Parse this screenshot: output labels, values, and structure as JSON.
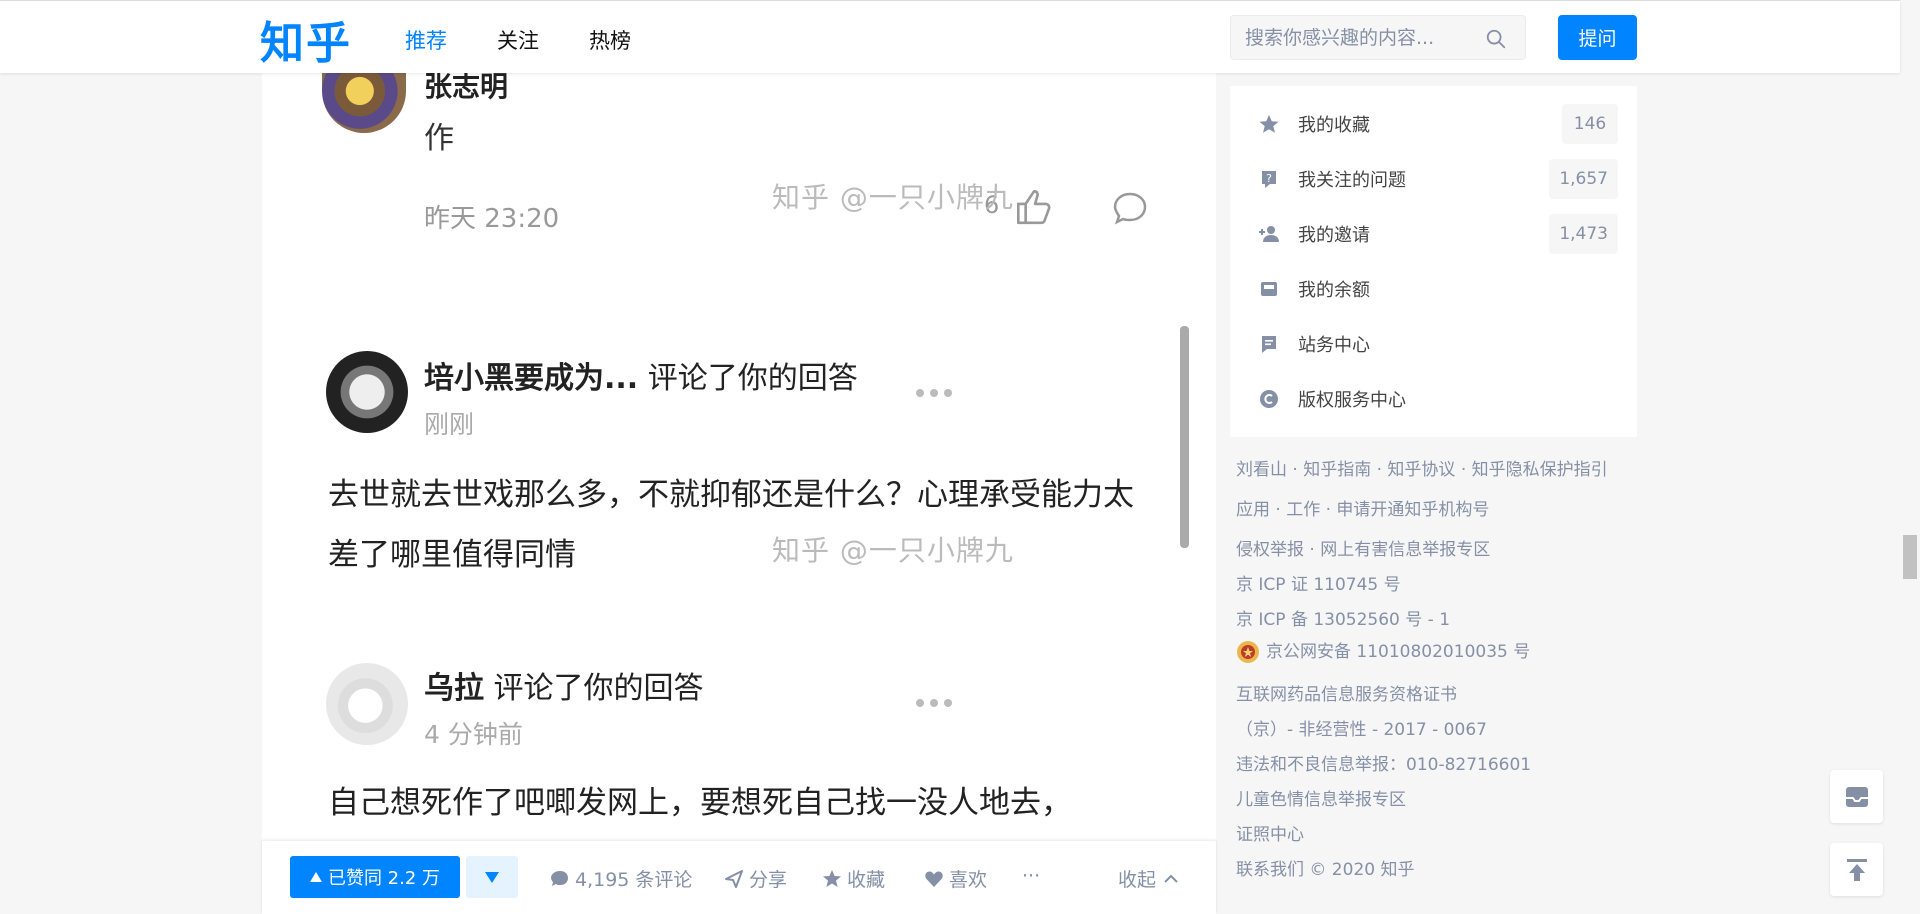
{
  "header": {
    "logo": "知乎",
    "nav": [
      {
        "label": "推荐"
      },
      {
        "label": "关注"
      },
      {
        "label": "热榜"
      }
    ],
    "search_placeholder": "搜索你感兴趣的内容...",
    "ask_label": "提问"
  },
  "answer_image": {
    "comment1": {
      "name": "张志明",
      "text": "作",
      "time": "昨天 23:20",
      "likes": "6"
    },
    "watermark": "知乎 @一只小牌九",
    "comment2": {
      "name": "培小黑要成为...",
      "action": " 评论了你的回答",
      "time": "刚刚",
      "text": "去世就去世戏那么多，不就抑郁还是什么？心理承受能力太差了哪里值得同情"
    },
    "comment3": {
      "name": "乌拉",
      "action": " 评论了你的回答",
      "time": "4 分钟前",
      "text": "自己想死作了吧唧发网上，要想死自己找一没人地去，"
    }
  },
  "action_bar": {
    "vote_label": "已赞同 2.2 万",
    "comments_label": "4,195 条评论",
    "share_label": "分享",
    "favorite_label": "收藏",
    "like_label": "喜欢",
    "more_label": "···",
    "collapse_label": "收起"
  },
  "sidebar": {
    "items": [
      {
        "label": "我的收藏",
        "count": "146",
        "icon": "star-icon"
      },
      {
        "label": "我关注的问题",
        "count": "1,657",
        "icon": "question-icon"
      },
      {
        "label": "我的邀请",
        "count": "1,473",
        "icon": "person-add-icon"
      },
      {
        "label": "我的余额",
        "count": "",
        "icon": "wallet-icon"
      },
      {
        "label": "站务中心",
        "count": "",
        "icon": "message-icon"
      },
      {
        "label": "版权服务中心",
        "count": "",
        "icon": "copyright-icon"
      }
    ]
  },
  "footer": {
    "lines": [
      "刘看山 · 知乎指南 · 知乎协议 · 知乎隐私保护指引",
      "应用 · 工作 · 申请开通知乎机构号",
      "侵权举报 · 网上有害信息举报专区",
      "京 ICP 证 110745 号",
      "京 ICP 备 13052560 号 - 1",
      "京公网安备 11010802010035 号",
      "互联网药品信息服务资格证书",
      "（京）- 非经营性 - 2017 - 0067",
      "违法和不良信息举报：010-82716601",
      "儿童色情信息举报专区",
      "证照中心",
      "联系我们 © 2020 知乎"
    ]
  },
  "colors": {
    "brand": "#0084ff",
    "muted": "#8590a6",
    "background": "#f6f6f6"
  }
}
